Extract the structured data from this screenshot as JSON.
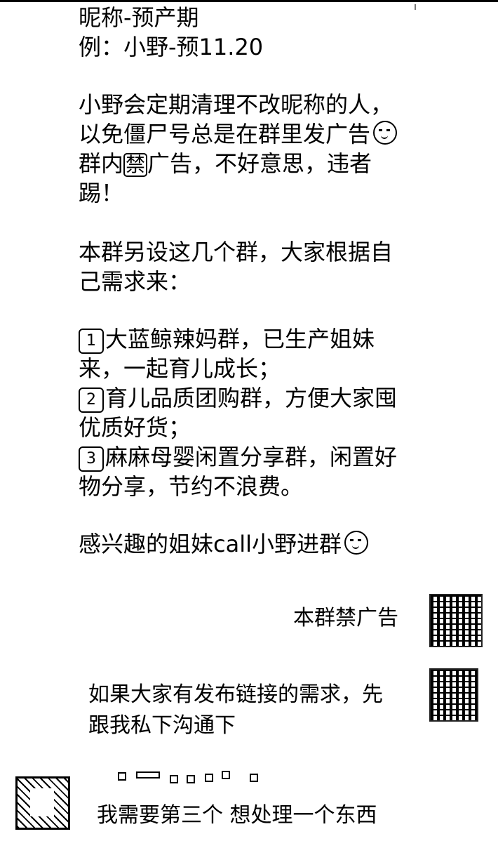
{
  "conversation": {
    "notice_message": {
      "lines": [
        "昵称-预产期",
        "例：小野-预11.20",
        "",
        "小野会定期清理不改昵称的人，",
        "以免僵尸号总是在群里发广告",
        "群内",
        "广告，不好意思，违者",
        "踢！",
        "",
        "本群另设这几个群，大家根据自",
        "己需求来：",
        "",
        "大蓝鲸辣妈群，已生产姐妹",
        "来，一起育儿成长；",
        "育儿品质团购群，方便大家囤",
        "优质好货；",
        "麻麻母婴闲置分享群，闲置好",
        "物分享，节约不浪费。",
        "",
        "感兴趣的姐妹call小野进群"
      ],
      "boxed_glyph": "禁",
      "num1": "1",
      "num2": "2",
      "num3": "3"
    },
    "right_message_1": "本群禁广告",
    "right_message_2_line1": "如果大家有发布链接的需求，先",
    "right_message_2_line2": "跟我私下沟通下",
    "left_message": "我需要第三个  想处理一个东西",
    "emoji_names": [
      "sad-face-icon",
      "smile-face-icon"
    ]
  }
}
